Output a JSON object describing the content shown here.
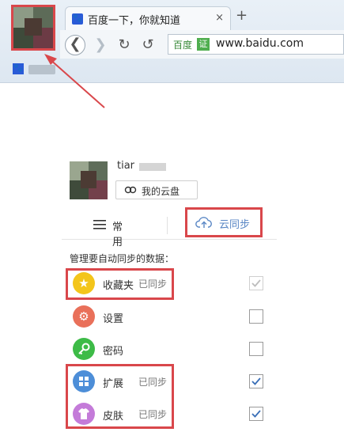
{
  "browser": {
    "tab_title": "百度一下，你就知道",
    "tab_close": "×",
    "new_tab": "+",
    "favicon": "paw-icon",
    "site_name": "百度",
    "cert_badge": "证",
    "url": "www.baidu.com",
    "nav": {
      "back": "❮",
      "forward": "❯",
      "reload": "↻",
      "undo": "↺"
    }
  },
  "panel": {
    "user_name": "tiar",
    "cloud_button": "我的云盘",
    "tabs": {
      "common": "常用",
      "sync": "云同步"
    },
    "section_title": "管理要自动同步的数据：",
    "items": [
      {
        "label": "收藏夹",
        "status": "已同步",
        "icon": "star-icon",
        "color": "#f3c51a",
        "checked": true,
        "disabled": true
      },
      {
        "label": "设置",
        "status": "",
        "icon": "gear-icon",
        "color": "#e9705a",
        "checked": false,
        "disabled": false
      },
      {
        "label": "密码",
        "status": "",
        "icon": "key-icon",
        "color": "#3dbb47",
        "checked": false,
        "disabled": false
      },
      {
        "label": "扩展",
        "status": "已同步",
        "icon": "grid-icon",
        "color": "#4d8ed8",
        "checked": true,
        "disabled": false
      },
      {
        "label": "皮肤",
        "status": "已同步",
        "icon": "shirt-icon",
        "color": "#c47bd9",
        "checked": true,
        "disabled": false
      }
    ]
  },
  "colors": {
    "highlight": "#d9474b",
    "accent": "#5a87c5"
  }
}
